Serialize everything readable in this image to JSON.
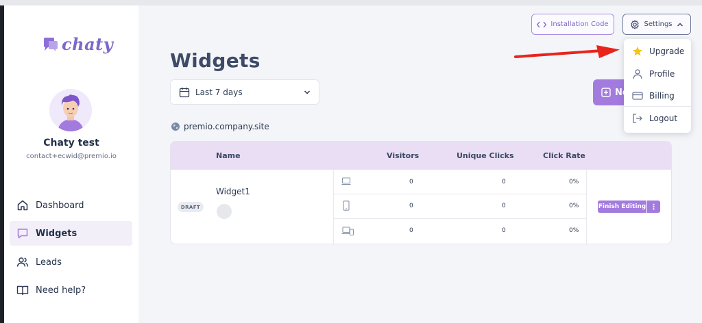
{
  "app": {
    "logo_text": "chaty",
    "brand_color": "#a37bdf"
  },
  "user": {
    "name": "Chaty test",
    "email": "contact+ecwid@premio.io"
  },
  "sidebar": {
    "items": [
      {
        "label": "Dashboard",
        "icon": "home-icon",
        "active": false
      },
      {
        "label": "Widgets",
        "icon": "chat-icon",
        "active": true
      },
      {
        "label": "Leads",
        "icon": "users-icon",
        "active": false
      },
      {
        "label": "Need help?",
        "icon": "book-icon",
        "active": false
      }
    ]
  },
  "header": {
    "installation_code_label": "Installation Code",
    "settings_label": "Settings"
  },
  "page": {
    "title": "Widgets",
    "date_range": "Last 7 days",
    "new_widget_label": "Ne",
    "site": "premio.company.site"
  },
  "table": {
    "columns": [
      "Name",
      "Visitors",
      "Unique Clicks",
      "Click Rate"
    ],
    "widget": {
      "status": "DRAFT",
      "name": "Widget1",
      "rows": [
        {
          "device": "desktop-icon",
          "visitors": "0",
          "unique_clicks": "0",
          "click_rate": "0%"
        },
        {
          "device": "mobile-icon",
          "visitors": "0",
          "unique_clicks": "0",
          "click_rate": "0%"
        },
        {
          "device": "all-devices-icon",
          "visitors": "0",
          "unique_clicks": "0",
          "click_rate": "0%"
        }
      ],
      "finish_label": "Finish Editing",
      "more_label": "⋮"
    }
  },
  "settings_menu": {
    "items": [
      {
        "label": "Upgrade",
        "icon": "star-icon"
      },
      {
        "label": "Profile",
        "icon": "user-icon"
      },
      {
        "label": "Billing",
        "icon": "credit-card-icon"
      },
      {
        "label": "Logout",
        "icon": "logout-icon"
      }
    ]
  }
}
